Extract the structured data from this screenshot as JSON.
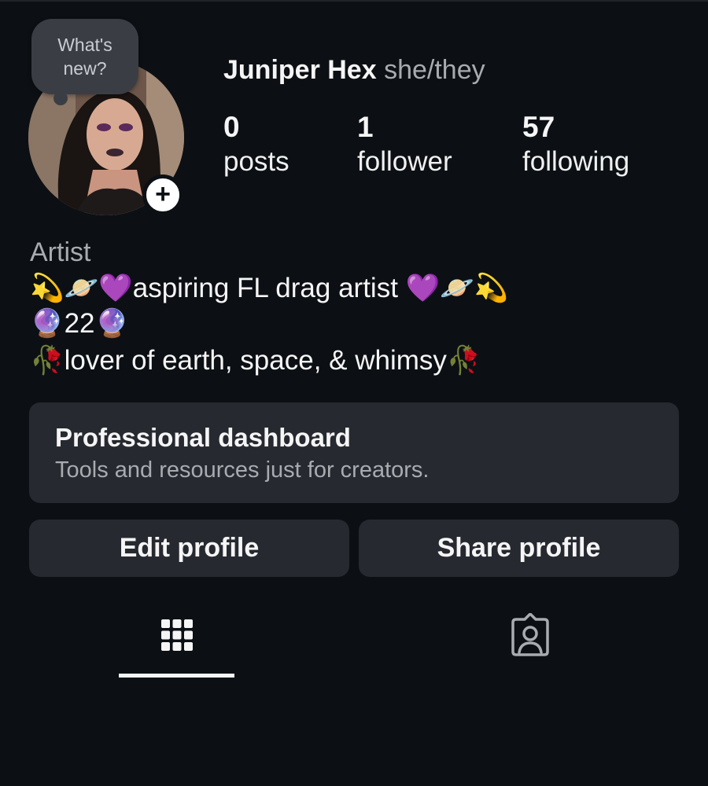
{
  "story_bubble": {
    "text": "What's\nnew?"
  },
  "profile": {
    "name": "Juniper Hex",
    "pronouns": "she/they"
  },
  "stats": [
    {
      "count": "0",
      "label": "posts"
    },
    {
      "count": "1",
      "label": "follower"
    },
    {
      "count": "57",
      "label": "following"
    }
  ],
  "bio": {
    "category": "Artist",
    "lines": [
      "💫🪐💜aspiring FL drag artist 💜🪐💫",
      "🔮22🔮",
      "🥀lover of earth, space, & whimsy🥀"
    ]
  },
  "pro_dashboard": {
    "title": "Professional dashboard",
    "subtitle": "Tools and resources just for creators."
  },
  "actions": {
    "edit_label": "Edit profile",
    "share_label": "Share profile"
  },
  "tabs": [
    {
      "icon": "grid-icon",
      "selected": true
    },
    {
      "icon": "tagged-icon",
      "selected": false
    }
  ],
  "colors": {
    "background": "#0c1014",
    "surface": "#262a30",
    "bubble": "#3a3e44",
    "text_primary": "#f5f5f5",
    "text_secondary": "#a8abb0",
    "icon_muted": "#a8abb0"
  }
}
